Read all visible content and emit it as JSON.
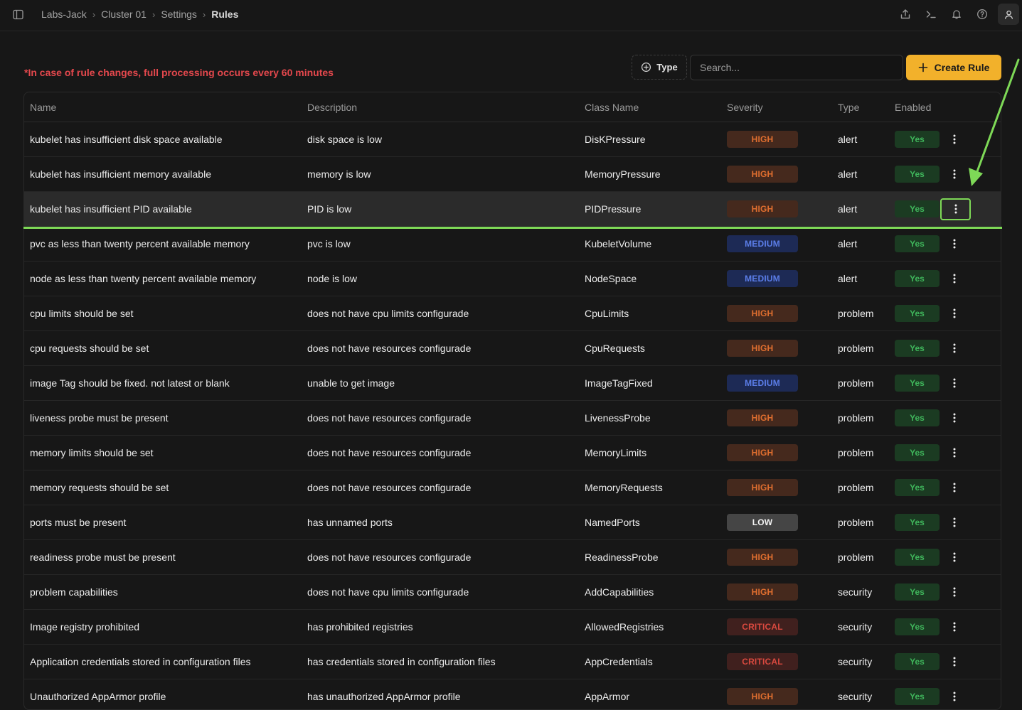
{
  "breadcrumb": [
    "Labs-Jack",
    "Cluster 01",
    "Settings",
    "Rules"
  ],
  "toolbar": {
    "notice": "*In case of rule changes, full processing occurs every 60 minutes",
    "type_label": "Type",
    "search_placeholder": "Search...",
    "create_label": "Create Rule"
  },
  "columns": [
    "Name",
    "Description",
    "Class Name",
    "Severity",
    "Type",
    "Enabled"
  ],
  "rows": [
    {
      "name": "kubelet has insufficient disk space available",
      "description": "disk space is low",
      "class_name": "DisKPressure",
      "severity": "HIGH",
      "type": "alert",
      "enabled": "Yes"
    },
    {
      "name": "kubelet has insufficient memory available",
      "description": "memory is low",
      "class_name": "MemoryPressure",
      "severity": "HIGH",
      "type": "alert",
      "enabled": "Yes"
    },
    {
      "name": "kubelet has insufficient PID available",
      "description": "PID is low",
      "class_name": "PIDPressure",
      "severity": "HIGH",
      "type": "alert",
      "enabled": "Yes"
    },
    {
      "name": "pvc as less than twenty percent available memory",
      "description": "pvc is low",
      "class_name": "KubeletVolume",
      "severity": "MEDIUM",
      "type": "alert",
      "enabled": "Yes"
    },
    {
      "name": "node as less than twenty percent available memory",
      "description": "node is low",
      "class_name": "NodeSpace",
      "severity": "MEDIUM",
      "type": "alert",
      "enabled": "Yes"
    },
    {
      "name": "cpu limits should be set",
      "description": "does not have cpu limits configurade",
      "class_name": "CpuLimits",
      "severity": "HIGH",
      "type": "problem",
      "enabled": "Yes"
    },
    {
      "name": "cpu requests should be set",
      "description": "does not have resources configurade",
      "class_name": "CpuRequests",
      "severity": "HIGH",
      "type": "problem",
      "enabled": "Yes"
    },
    {
      "name": "image Tag should be fixed. not latest or blank",
      "description": "unable to get image",
      "class_name": "ImageTagFixed",
      "severity": "MEDIUM",
      "type": "problem",
      "enabled": "Yes"
    },
    {
      "name": "liveness probe must be present",
      "description": "does not have resources configurade",
      "class_name": "LivenessProbe",
      "severity": "HIGH",
      "type": "problem",
      "enabled": "Yes"
    },
    {
      "name": "memory limits should be set",
      "description": "does not have resources configurade",
      "class_name": "MemoryLimits",
      "severity": "HIGH",
      "type": "problem",
      "enabled": "Yes"
    },
    {
      "name": "memory requests should be set",
      "description": "does not have resources configurade",
      "class_name": "MemoryRequests",
      "severity": "HIGH",
      "type": "problem",
      "enabled": "Yes"
    },
    {
      "name": "ports must be present",
      "description": "has unnamed ports",
      "class_name": "NamedPorts",
      "severity": "LOW",
      "type": "problem",
      "enabled": "Yes"
    },
    {
      "name": "readiness probe must be present",
      "description": "does not have resources configurade",
      "class_name": "ReadinessProbe",
      "severity": "HIGH",
      "type": "problem",
      "enabled": "Yes"
    },
    {
      "name": "problem capabilities",
      "description": "does not have cpu limits configurade",
      "class_name": "AddCapabilities",
      "severity": "HIGH",
      "type": "security",
      "enabled": "Yes"
    },
    {
      "name": "Image registry prohibited",
      "description": "has prohibited registries",
      "class_name": "AllowedRegistries",
      "severity": "CRITICAL",
      "type": "security",
      "enabled": "Yes"
    },
    {
      "name": "Application credentials stored in configuration files",
      "description": "has credentials stored in configuration files",
      "class_name": "AppCredentials",
      "severity": "CRITICAL",
      "type": "security",
      "enabled": "Yes"
    },
    {
      "name": "Unauthorized AppArmor profile",
      "description": "has unauthorized AppArmor profile",
      "class_name": "AppArmor",
      "severity": "HIGH",
      "type": "security",
      "enabled": "Yes"
    }
  ],
  "highlighted_row": 2,
  "colors": {
    "accent": "#f2b12b",
    "notice": "#e5484d",
    "annotation": "#7ed957"
  }
}
